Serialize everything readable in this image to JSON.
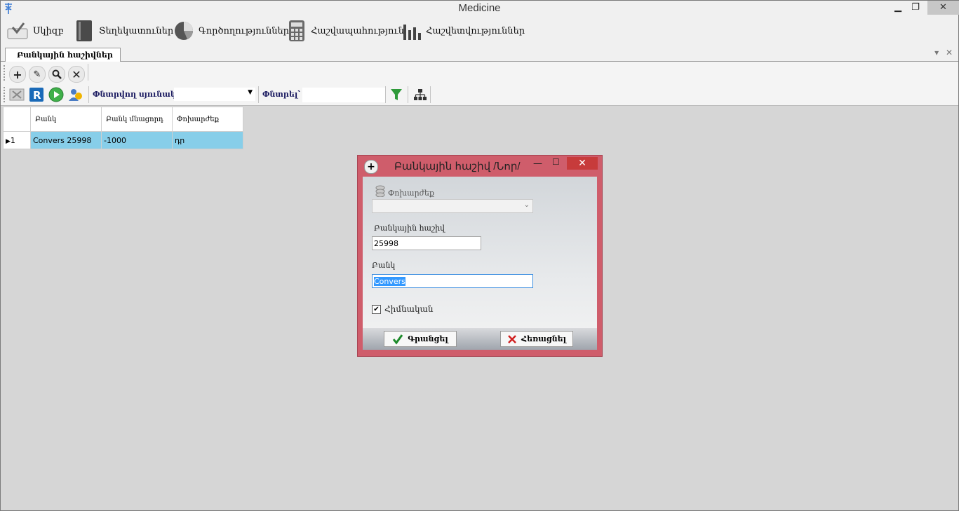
{
  "window": {
    "title": "Medicine"
  },
  "menu": {
    "items": [
      {
        "label": "Սկիզբ",
        "icon": "home-start-icon"
      },
      {
        "label": "Տեղեկատուներ",
        "icon": "binder-icon"
      },
      {
        "label": "Գործողություններ",
        "icon": "pie-chart-icon"
      },
      {
        "label": "Հաշվապահություն",
        "icon": "calculator-icon"
      },
      {
        "label": "Հաշվետվություններ",
        "icon": "bar-chart-icon"
      }
    ]
  },
  "tabs": {
    "active": "Բանկային հաշիվներ"
  },
  "toolbar1": {
    "buttons": [
      "add-icon",
      "edit-icon",
      "search-icon",
      "delete-icon"
    ]
  },
  "toolbar2": {
    "search_column_label": "Փնտրվող սյունակ՝",
    "search_label": "Փնտրել՝",
    "search_value": ""
  },
  "grid": {
    "columns": [
      "Բանկ",
      "Բանկ մնացորդ",
      "Փոխարժեք"
    ],
    "rows": [
      {
        "index": "1",
        "bank": "Convers 25998",
        "balance": "-1000",
        "currency": "դր"
      }
    ]
  },
  "dialog": {
    "title": "Բանկային հաշիվ /Նոր/",
    "currency_label": "Փոխարժեք",
    "currency_value": "",
    "account_label": "Բանկային հաշիվ",
    "account_value": "25998",
    "bank_label": "Բանկ",
    "bank_value": "Convers",
    "primary_label": "Հիմնական",
    "primary_checked": true,
    "ok_label": "Գրանցել",
    "cancel_label": "Հեռացնել"
  },
  "colors": {
    "dialog_frame": "#cf5d6b",
    "selected_row": "#87cee9",
    "close_button": "#c73b3b"
  }
}
